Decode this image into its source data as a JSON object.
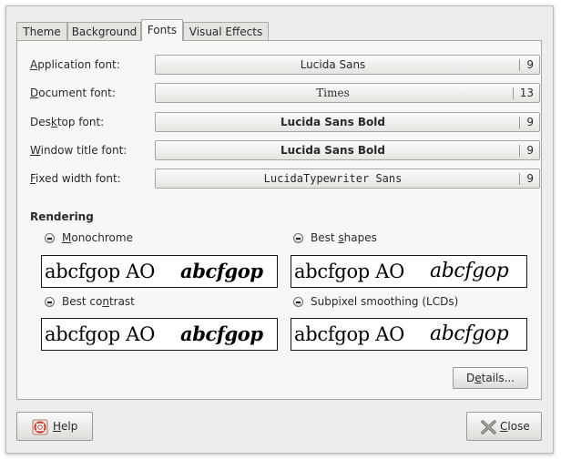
{
  "tabs": [
    "Theme",
    "Background",
    "Fonts",
    "Visual Effects"
  ],
  "active_tab": "Fonts",
  "font_rows": [
    {
      "label_mnemonic": "A",
      "label_rest": "pplication font:",
      "font": "Lucida Sans",
      "size": "9"
    },
    {
      "label_mnemonic": "D",
      "label_rest": "ocument font:",
      "font": "Times",
      "size": "13"
    },
    {
      "label_pre": "Des",
      "label_mnemonic": "k",
      "label_rest": "top font:",
      "font": "Lucida Sans Bold",
      "size": "9"
    },
    {
      "label_mnemonic": "W",
      "label_rest": "indow title font:",
      "font": "Lucida Sans Bold",
      "size": "9"
    },
    {
      "label_mnemonic": "F",
      "label_rest": "ixed width font:",
      "font": "LucidaTypewriter Sans",
      "size": "9"
    }
  ],
  "rendering": {
    "title": "Rendering",
    "sample_plain": "abcfgop AO",
    "sample_italic": "abcfgop",
    "options": [
      {
        "pre": " ",
        "mnemonic": "M",
        "rest": "onochrome"
      },
      {
        "pre": "Best ",
        "mnemonic": "s",
        "rest": "hapes"
      },
      {
        "pre": "Best co",
        "mnemonic": "n",
        "rest": "trast"
      },
      {
        "pre": "Subpixel smoothing (LCDs)",
        "mnemonic": "",
        "rest": ""
      }
    ]
  },
  "buttons": {
    "details": {
      "pre": "D",
      "mnemonic": "e",
      "rest": "tails..."
    },
    "help": {
      "mnemonic": "H",
      "rest": "elp"
    },
    "close": {
      "mnemonic": "C",
      "rest": "lose"
    }
  },
  "icons": {
    "help": "help-lifebuoy-icon",
    "close": "close-x-icon"
  }
}
